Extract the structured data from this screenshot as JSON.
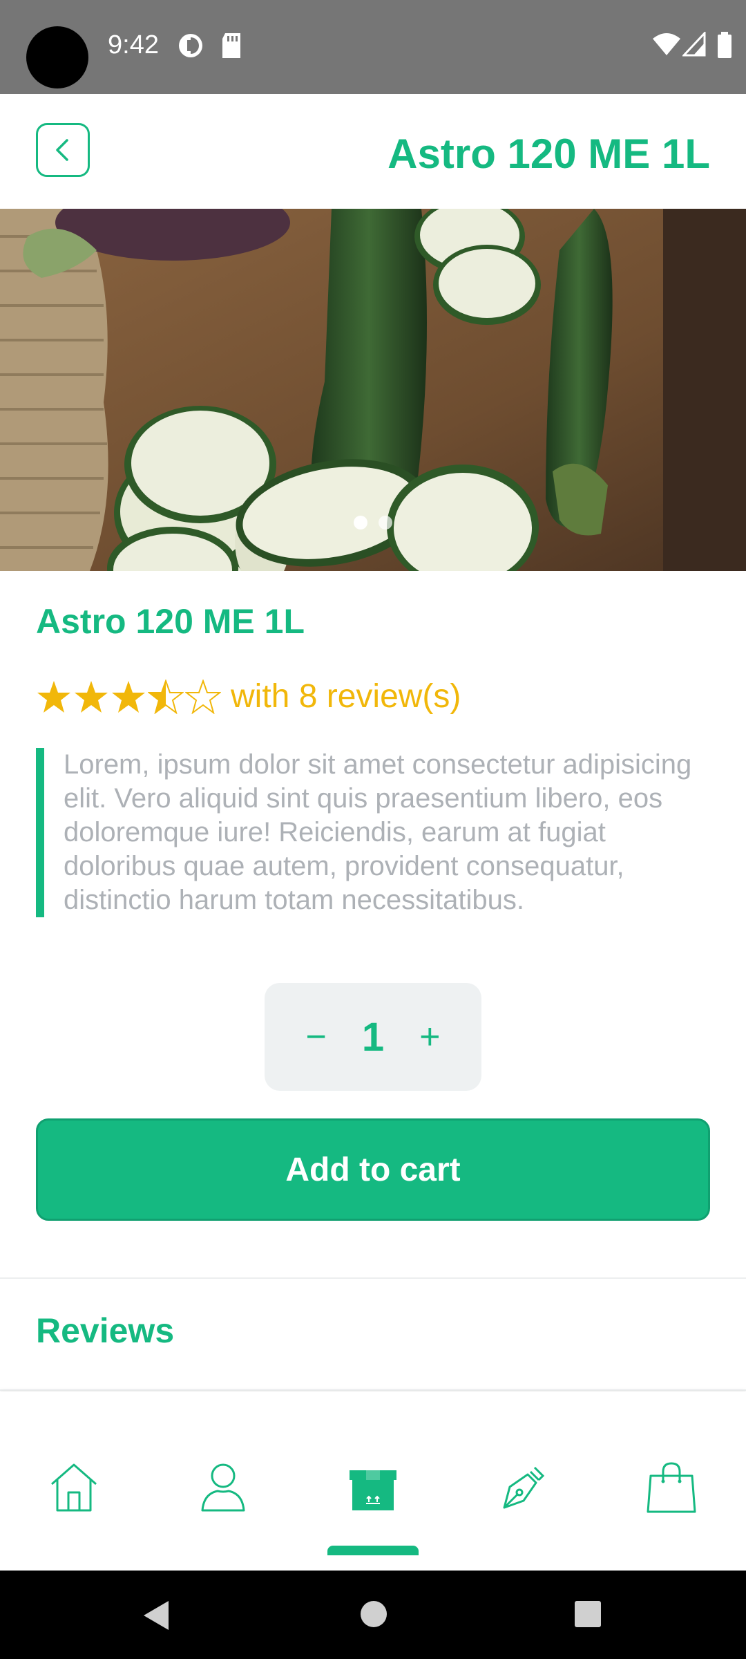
{
  "status_bar": {
    "time": "9:42"
  },
  "app_bar": {
    "title": "Astro 120 ME 1L",
    "back_icon": "chevron-left-icon"
  },
  "hero": {
    "image_subject": "sliced zucchini on wooden cutting board",
    "page_indicator": {
      "count": 2,
      "active_index": 0
    }
  },
  "product": {
    "name": "Astro 120 ME 1L",
    "rating": 3.5,
    "max_rating": 5,
    "review_text": "with 8 review(s)",
    "description": "Lorem, ipsum dolor sit amet consectetur adipisicing elit. Vero aliquid sint quis praesentium libero, eos doloremque iure! Reiciendis, earum at fugiat doloribus quae autem, provident consequatur, distinctio harum totam necessitatibus."
  },
  "quantity": {
    "minus": "−",
    "value": "1",
    "plus": "+"
  },
  "add_to_cart_label": "Add to cart",
  "reviews_title": "Reviews",
  "bottom_nav": {
    "items": [
      {
        "icon": "home-icon"
      },
      {
        "icon": "user-icon"
      },
      {
        "icon": "box-icon",
        "active": true
      },
      {
        "icon": "pen-icon"
      },
      {
        "icon": "shopping-bag-icon"
      }
    ]
  },
  "colors": {
    "accent": "#15b981",
    "star": "#f1b70a",
    "description_text": "#adb1b6",
    "status_bar": "#767676"
  }
}
